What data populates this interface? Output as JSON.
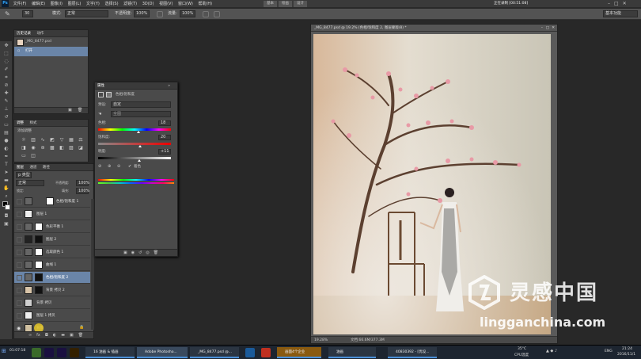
{
  "menubar": {
    "logo": "Ps",
    "items": [
      "文件(F)",
      "编辑(E)",
      "图像(I)",
      "图层(L)",
      "文字(Y)",
      "选择(S)",
      "滤镜(T)",
      "3D(D)",
      "视图(V)",
      "窗口(W)",
      "帮助(H)"
    ],
    "workspace_tabs": [
      "基本",
      "绘画",
      "设计"
    ],
    "recording": "正在录制 [00:51:08]"
  },
  "optbar": {
    "brush_size": "30",
    "mode_label": "模式:",
    "mode_value": "正常",
    "opacity_label": "不透明度:",
    "opacity_value": "100%",
    "flow_label": "流量:",
    "flow_value": "100%",
    "workspace": "基本功能"
  },
  "history": {
    "tabs": [
      "历史记录",
      "动作"
    ],
    "items": [
      "_MG_8477.psd",
      "打开"
    ]
  },
  "adjust": {
    "tabs": [
      "调整",
      "样式"
    ],
    "title": "添加调整"
  },
  "layers": {
    "tabs": [
      "图层",
      "通道",
      "路径"
    ],
    "kind": "p 类型",
    "blend": "正常",
    "opacity_label": "不透明度:",
    "opacity": "100%",
    "lock_label": "锁定:",
    "fill_label": "填充:",
    "fill": "100%",
    "rows": [
      "色相/饱和度 1",
      "图层 1",
      "色彩平衡 1",
      "图层 2",
      "选取颜色 1",
      "曲线 1",
      "色相/饱和度 2",
      "背景 拷贝 2",
      "背景 拷贝",
      "图层 1 拷贝",
      "背景"
    ]
  },
  "properties": {
    "title": "属性",
    "panel_name": "色相/饱和度",
    "preset_label": "预设:",
    "preset_value": "自定",
    "channel_value": "全图",
    "hue_label": "色相:",
    "hue_value": "18",
    "sat_label": "饱和度:",
    "sat_value": "20",
    "light_label": "明度:",
    "light_value": "+11",
    "colorize": "着色"
  },
  "document": {
    "title": "_MG_8477.psd @ 19.2% (色相/饱和度 2, 图层蒙版/8) *",
    "zoom": "19.28%",
    "docinfo": "文档:66.6M/377.3M"
  },
  "watermark": {
    "cn": "灵感中国",
    "en": "lingganchina.com"
  },
  "taskbar": {
    "items": [
      "16 油画 & 插画",
      "Adobe Photosho...",
      "_MG_8477.psd @...",
      "画面4个企业",
      "油画",
      "40830392 - [优设..."
    ],
    "clock_time": "21:24",
    "clock_date": "2016/11/1",
    "weather": "35°C",
    "cpu": "CPU温度",
    "lang": "ENG",
    "start_time": "01:07:18"
  }
}
